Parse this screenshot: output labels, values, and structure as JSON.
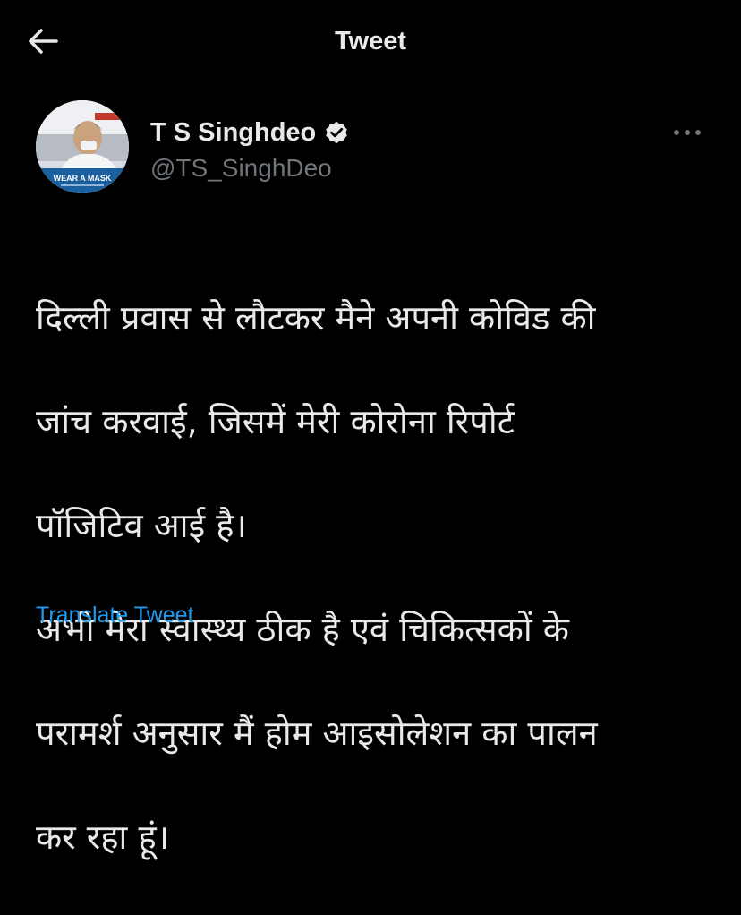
{
  "header": {
    "title": "Tweet",
    "back_icon": "arrow-left-icon"
  },
  "author": {
    "name": "T S Singhdeo",
    "handle": "@TS_SinghDeo",
    "verified": true,
    "avatar_badge_text": "WEAR A MASK",
    "more_icon": "more-horizontal-icon"
  },
  "tweet": {
    "lines": [
      "दिल्ली प्रवास से लौटकर मैने अपनी कोविड की",
      "जांच करवाई, जिसमें मेरी कोरोना रिपोर्ट",
      "पॉजिटिव आई है।",
      "अभी मेरा स्वास्थ्य ठीक है एवं चिकित्सकों के",
      "परामर्श अनुसार मैं होम आइसोलेशन का पालन",
      "कर रहा हूं।"
    ]
  },
  "actions": {
    "translate_label": "Translate Tweet"
  },
  "colors": {
    "background": "#000000",
    "text": "#e7e9ea",
    "secondary": "#71767b",
    "link": "#1d9bf0"
  }
}
